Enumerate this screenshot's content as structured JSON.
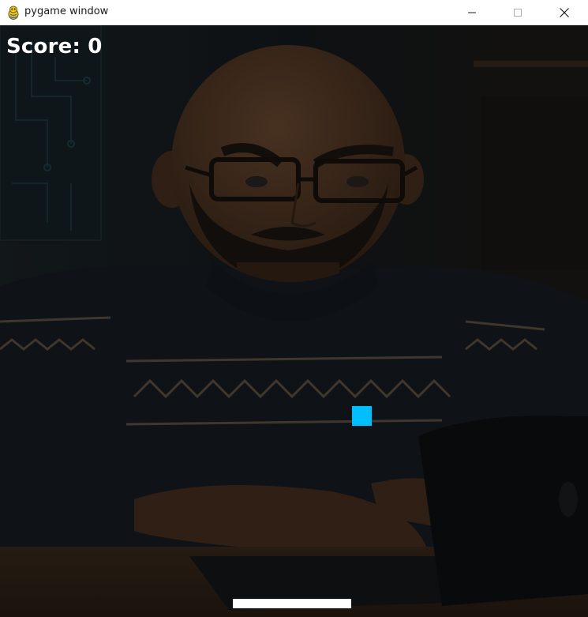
{
  "window": {
    "title": "pygame window",
    "controls": {
      "minimize_icon": "minimize-icon",
      "maximize_icon": "maximize-icon",
      "close_icon": "close-icon"
    }
  },
  "game": {
    "score_text": "Score: 0",
    "score": 0,
    "colors": {
      "ball": "#00bfff",
      "paddle": "#ffffff",
      "score_text": "#ffffff"
    },
    "background_image": "dimmed illustration of a bald bearded man with glasses in a patterned sweater typing on a laptop"
  }
}
